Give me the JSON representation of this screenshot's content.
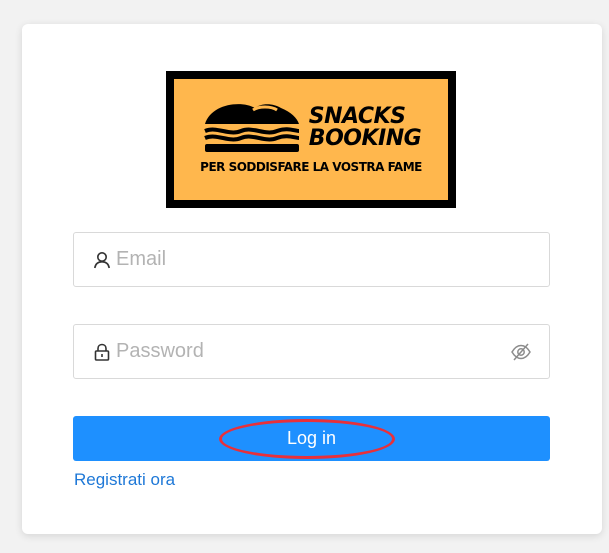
{
  "logo": {
    "line1": "SNACKS",
    "line2": "BOOKING",
    "tagline": "PER SODDISFARE LA VOSTRA FAME",
    "background_color": "#ffb74d",
    "border_color": "#000000"
  },
  "form": {
    "email": {
      "placeholder": "Email",
      "value": "",
      "icon": "user-icon"
    },
    "password": {
      "placeholder": "Password",
      "value": "",
      "icon": "lock-icon",
      "toggle_icon": "eye-slash-icon"
    },
    "login_label": "Log in",
    "register_label": "Registrati ora"
  },
  "colors": {
    "primary": "#1e90ff",
    "link": "#1e78d7",
    "annotation": "#e8303a"
  }
}
